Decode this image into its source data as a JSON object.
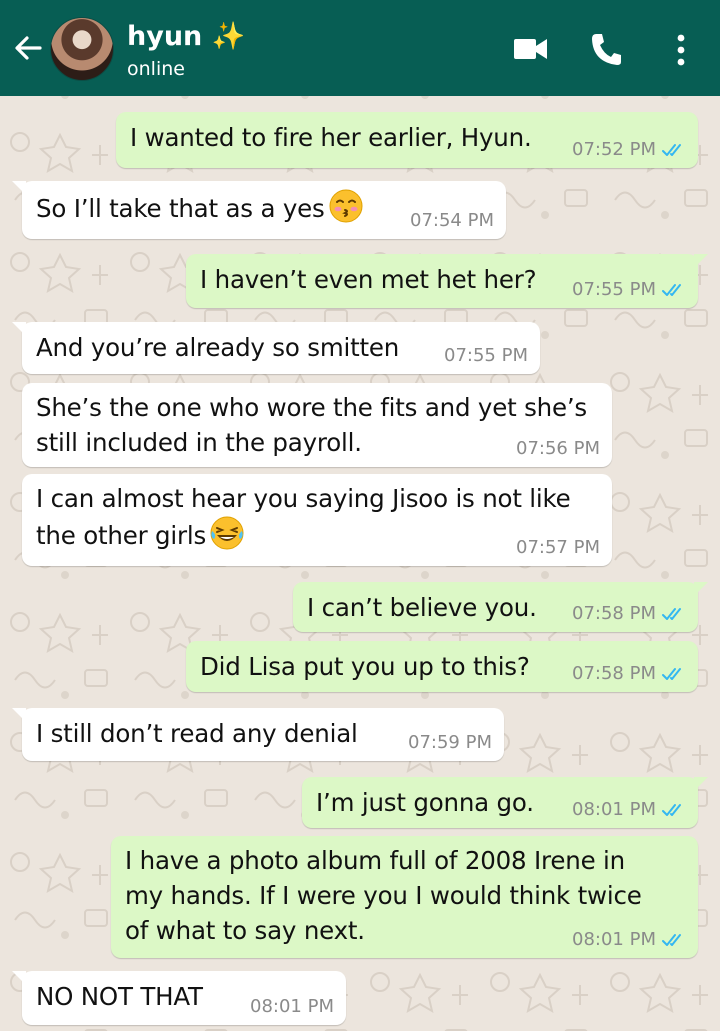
{
  "header": {
    "contact_name": "hyun ✨",
    "status": "online",
    "icons": [
      "back-arrow-icon",
      "video-call-icon",
      "phone-call-icon",
      "more-options-icon"
    ]
  },
  "messages": [
    {
      "direction": "out",
      "text": "I wanted to fire her earlier, Hyun.",
      "time": "07:52 PM",
      "read": true
    },
    {
      "direction": "in",
      "text": "So I’ll take that as a yes",
      "emoji": "kissing-face-emoji",
      "time": "07:54 PM"
    },
    {
      "direction": "out",
      "text": "I haven’t even met het her?",
      "time": "07:55 PM",
      "read": true
    },
    {
      "direction": "in",
      "text": "And you’re already so smitten",
      "time": "07:55 PM"
    },
    {
      "direction": "in",
      "text": "She’s the one who wore the fits and yet she’s\nstill included in the payroll.",
      "time": "07:56 PM"
    },
    {
      "direction": "in",
      "text": "I can almost hear you saying Jisoo is not like\nthe other girls",
      "emoji": "tears-of-joy-emoji",
      "time": "07:57 PM"
    },
    {
      "direction": "out",
      "text": "I can’t believe you.",
      "time": "07:58 PM",
      "read": true
    },
    {
      "direction": "out",
      "text": "Did Lisa put you up to this?",
      "time": "07:58 PM",
      "read": true
    },
    {
      "direction": "in",
      "text": "I still don’t read any denial",
      "time": "07:59 PM"
    },
    {
      "direction": "out",
      "text": "I’m just gonna go.",
      "time": "08:01 PM",
      "read": true
    },
    {
      "direction": "out",
      "text": "I have a photo album full of 2008 Irene in\nmy hands. If I were you I would think twice\nof what to say next.",
      "time": "08:01 PM",
      "read": true
    },
    {
      "direction": "in",
      "text": "NO NOT THAT",
      "time": "08:01 PM"
    }
  ],
  "colors": {
    "header": "#075e54",
    "background": "#ece5dd",
    "outgoing_bubble": "#dcf8c6",
    "incoming_bubble": "#ffffff",
    "read_ticks": "#34b7f1"
  }
}
